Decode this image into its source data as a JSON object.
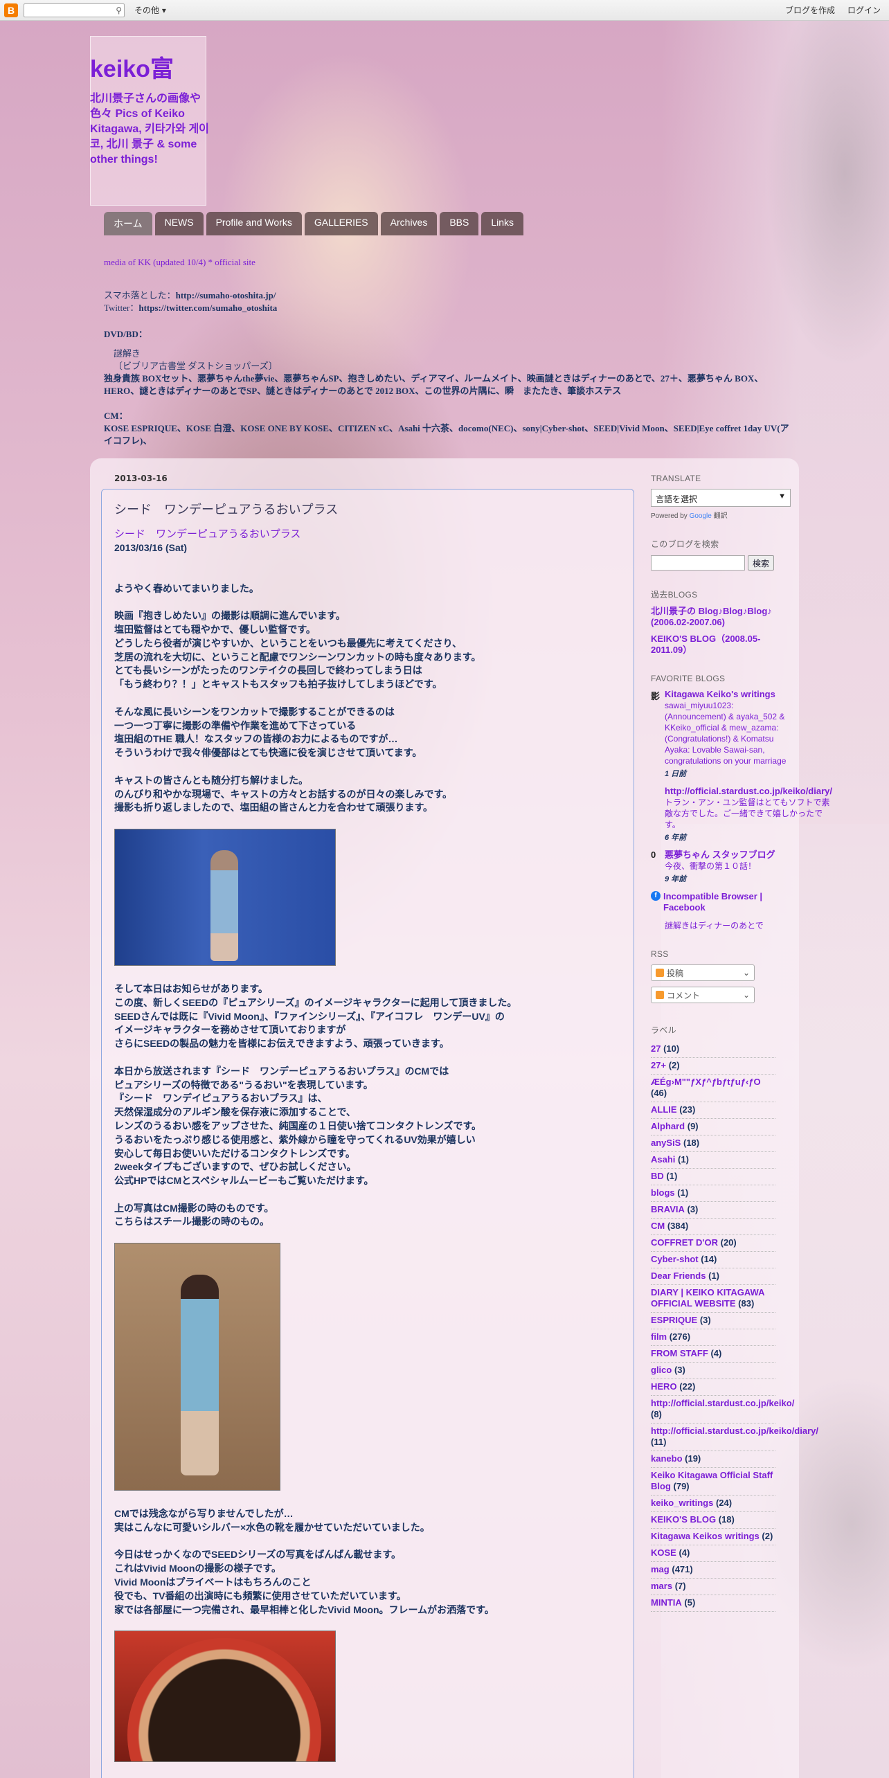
{
  "navbar": {
    "logo": "B",
    "more": "その他 ▾",
    "create_blog": "ブログを作成",
    "login": "ログイン"
  },
  "header": {
    "title": "keiko富",
    "description": "北川景子さんの画像や色々   Pics of Keiko Kitagawa, 키타가와 게이코, 北川 景子 & some other things!"
  },
  "tabs": [
    "ホーム",
    "NEWS",
    "Profile and Works",
    "GALLERIES",
    "Archives",
    "BBS",
    "Links"
  ],
  "info": {
    "media_line": "media of KK (updated 10/4)          * official site ",
    "promo_label": "スマホ落とした：",
    "promo_url": "http://sumaho-otoshita.jp/",
    "twitter_label": "Twitter：",
    "twitter_url": "https://twitter.com/sumaho_otoshita",
    "dvd_label": "DVD/BD：",
    "dvd_sub": "謎解き",
    "dvd_sub2": "〔ビブリア古書堂 ダストショッパーズ〕",
    "dvd_list": "独身貴族 BOXセット、悪夢ちゃんthe夢vie、悪夢ちゃんSP、抱きしめたい、ディアマイ、ルームメイト、映画謎ときはディナーのあとで、27＋、悪夢ちゃん BOX、HERO、謎ときはディナーのあとでSP、謎ときはディナーのあとで 2012 BOX、この世界の片隅に、瞬　またたき、筆談ホステス",
    "cm_label": "CM：",
    "cm_list": "KOSE ESPRIQUE、KOSE 白澄、KOSE ONE BY KOSE、CITIZEN xC、Asahi 十六茶、docomo(NEC)、sony|Cyber-shot、SEED|Vivid Moon、SEED|Eye coffret 1day UV(アイコフレ)、"
  },
  "post": {
    "date_header": "2013-03-16",
    "title": "シード　ワンデーピュアうるおいプラス",
    "sub_title": "シード　ワンデーピュアうるおいプラス",
    "sub_date": "2013/03/16 (Sat)",
    "paragraphs": [
      "ようやく春めいてまいりました。",
      "映画『抱きしめたい』の撮影は順調に進んでいます。\n塩田監督はとても穏やかで、優しい監督です。\nどうしたら役者が演じやすいか、ということをいつも最優先に考えてくださり、\n芝居の流れを大切に、ということ配慮でワンシーンワンカットの時も度々あります。\nとても長いシーンがたったのワンテイクの長回しで終わってしまう日は\n「もう終わり？！」とキャストもスタッフも拍子抜けしてしまうほどです。",
      "そんな風に長いシーンをワンカットで撮影することができるのは\n一つ一つ丁寧に撮影の準備や作業を進めて下さっている\n塩田組のTHE 職人！なスタッフの皆様のお力によるものですが…\nそういうわけで我々俳優部はとても快適に役を演じさせて頂いてます。",
      "キャストの皆さんとも随分打ち解けました。\nのんびり和やかな現場で、キャストの方々とお話するのが日々の楽しみです。\n撮影も折り返しましたので、塩田組の皆さんと力を合わせて頑張ります。"
    ],
    "paragraphs2": [
      "そして本日はお知らせがあります。\nこの度、新しくSEEDの『ピュアシリーズ』のイメージキャラクターに起用して頂きました。\nSEEDさんでは既に『Vivid Moon』、『ファインシリーズ』、『アイコフレ　ワンデーUV』の\nイメージキャラクターを務めさせて頂いておりますが\nさらにSEEDの製品の魅力を皆様にお伝えできますよう、頑張っていきます。",
      "本日から放送されます『シード　ワンデーピュアうるおいプラス』のCMでは\nピュアシリーズの特徴である\"うるおい\"を表現しています。\n『シード　ワンデイピュアうるおいプラス』は、\n天然保湿成分のアルギン酸を保存液に添加することで、\nレンズのうるおい感をアップさせた、純国産の１日使い捨てコンタクトレンズです。\nうるおいをたっぷり感じる使用感と、紫外線から瞳を守ってくれるUV効果が嬉しい\n安心して毎日お使いいただけるコンタクトレンズです。\n2weekタイプもございますので、ぜひお試しください。\n公式HPではCMとスペシャルムービーもご覧いただけます。",
      "上の写真はCM撮影の時のものです。\nこちらはスチール撮影の時のもの。"
    ],
    "paragraphs3": [
      "CMでは残念ながら写りませんでしたが…\n実はこんなに可愛いシルバー×水色の靴を履かせていただいていました。",
      "今日はせっかくなのでSEEDシリーズの写真をばんばん載せます。\nこれはVivid Moonの撮影の様子です。\nVivid Moonはプライベートはもちろんのこと\n役でも、TV番組の出演時にも頻繁に使用させていただいています。\n家では各部屋に一つ完備され、最早相棒と化したVivid Moon。フレームがお洒落です。"
    ]
  },
  "sidebar": {
    "translate": {
      "heading": "TRANSLATE",
      "select_label": "言語を選択",
      "powered_by": "Powered by",
      "google": "Google",
      "translate_word": "翻訳"
    },
    "search": {
      "heading": "このブログを検索",
      "button": "検索"
    },
    "past_blogs": {
      "heading": "過去BLOGS",
      "links": [
        "北川景子の Blog♪Blog♪Blog♪ (2006.02-2007.06)",
        "KEIKO'S BLOG（2008.05-2011.09）"
      ]
    },
    "favorite_blogs": {
      "heading": "FAVORITE BLOGS",
      "items": [
        {
          "icon": "影",
          "title": "Kitagawa Keiko's writings",
          "snippet": "sawai_miyuu1023: (Announcement) & ayaka_502 & KKeiko_official & mew_azama: (Congratulations!) & Komatsu Ayaka: Lovable Sawai-san, congratulations on your marriage",
          "time": "1 日前"
        },
        {
          "icon": "",
          "title": "http://official.stardust.co.jp/keiko/diary/",
          "snippet": "トラン・アン・ユン監督はとてもソフトで素敵な方でした。ご一緒できて嬉しかったです。",
          "time": "6 年前"
        },
        {
          "icon": "0",
          "title": "悪夢ちゃん スタッフブログ",
          "snippet": "今夜、衝撃の第１０話！",
          "time": "9 年前"
        },
        {
          "icon": "f",
          "title": "Incompatible Browser | Facebook",
          "snippet": "",
          "time": ""
        },
        {
          "icon": "",
          "title": "",
          "snippet": "謎解きはディナーのあとで",
          "time": ""
        }
      ]
    },
    "rss": {
      "heading": "RSS",
      "posts": "投稿",
      "comments": "コメント"
    },
    "labels": {
      "heading": "ラベル",
      "items": [
        {
          "name": "27",
          "count": "(10)"
        },
        {
          "name": "27+",
          "count": "(2)"
        },
        {
          "name": "ÆÉg›M\"\"ƒXƒ^ƒbƒtƒuƒ‹ƒO",
          "count": "(46)"
        },
        {
          "name": "ALLIE",
          "count": "(23)"
        },
        {
          "name": "Alphard",
          "count": "(9)"
        },
        {
          "name": "anySiS",
          "count": "(18)"
        },
        {
          "name": "Asahi",
          "count": "(1)"
        },
        {
          "name": "BD",
          "count": "(1)"
        },
        {
          "name": "blogs",
          "count": "(1)"
        },
        {
          "name": "BRAVIA",
          "count": "(3)"
        },
        {
          "name": "CM",
          "count": "(384)"
        },
        {
          "name": "COFFRET D'OR",
          "count": "(20)"
        },
        {
          "name": "Cyber-shot",
          "count": "(14)"
        },
        {
          "name": "Dear Friends",
          "count": "(1)"
        },
        {
          "name": "DIARY | KEIKO KITAGAWA OFFICIAL WEBSITE",
          "count": "(83)"
        },
        {
          "name": "ESPRIQUE",
          "count": "(3)"
        },
        {
          "name": "film",
          "count": "(276)"
        },
        {
          "name": "FROM STAFF",
          "count": "(4)"
        },
        {
          "name": "glico",
          "count": "(3)"
        },
        {
          "name": "HERO",
          "count": "(22)"
        },
        {
          "name": "http://official.stardust.co.jp/keiko/",
          "count": "(8)"
        },
        {
          "name": "http://official.stardust.co.jp/keiko/diary/",
          "count": "(11)"
        },
        {
          "name": "kanebo",
          "count": "(19)"
        },
        {
          "name": "Keiko Kitagawa Official Staff Blog",
          "count": "(79)"
        },
        {
          "name": "keiko_writings",
          "count": "(24)"
        },
        {
          "name": "KEIKO'S BLOG",
          "count": "(18)"
        },
        {
          "name": "Kitagawa Keikos writings",
          "count": "(2)"
        },
        {
          "name": "KOSE",
          "count": "(4)"
        },
        {
          "name": "mag",
          "count": "(471)"
        },
        {
          "name": "mars",
          "count": "(7)"
        },
        {
          "name": "MINTIA",
          "count": "(5)"
        }
      ]
    }
  }
}
